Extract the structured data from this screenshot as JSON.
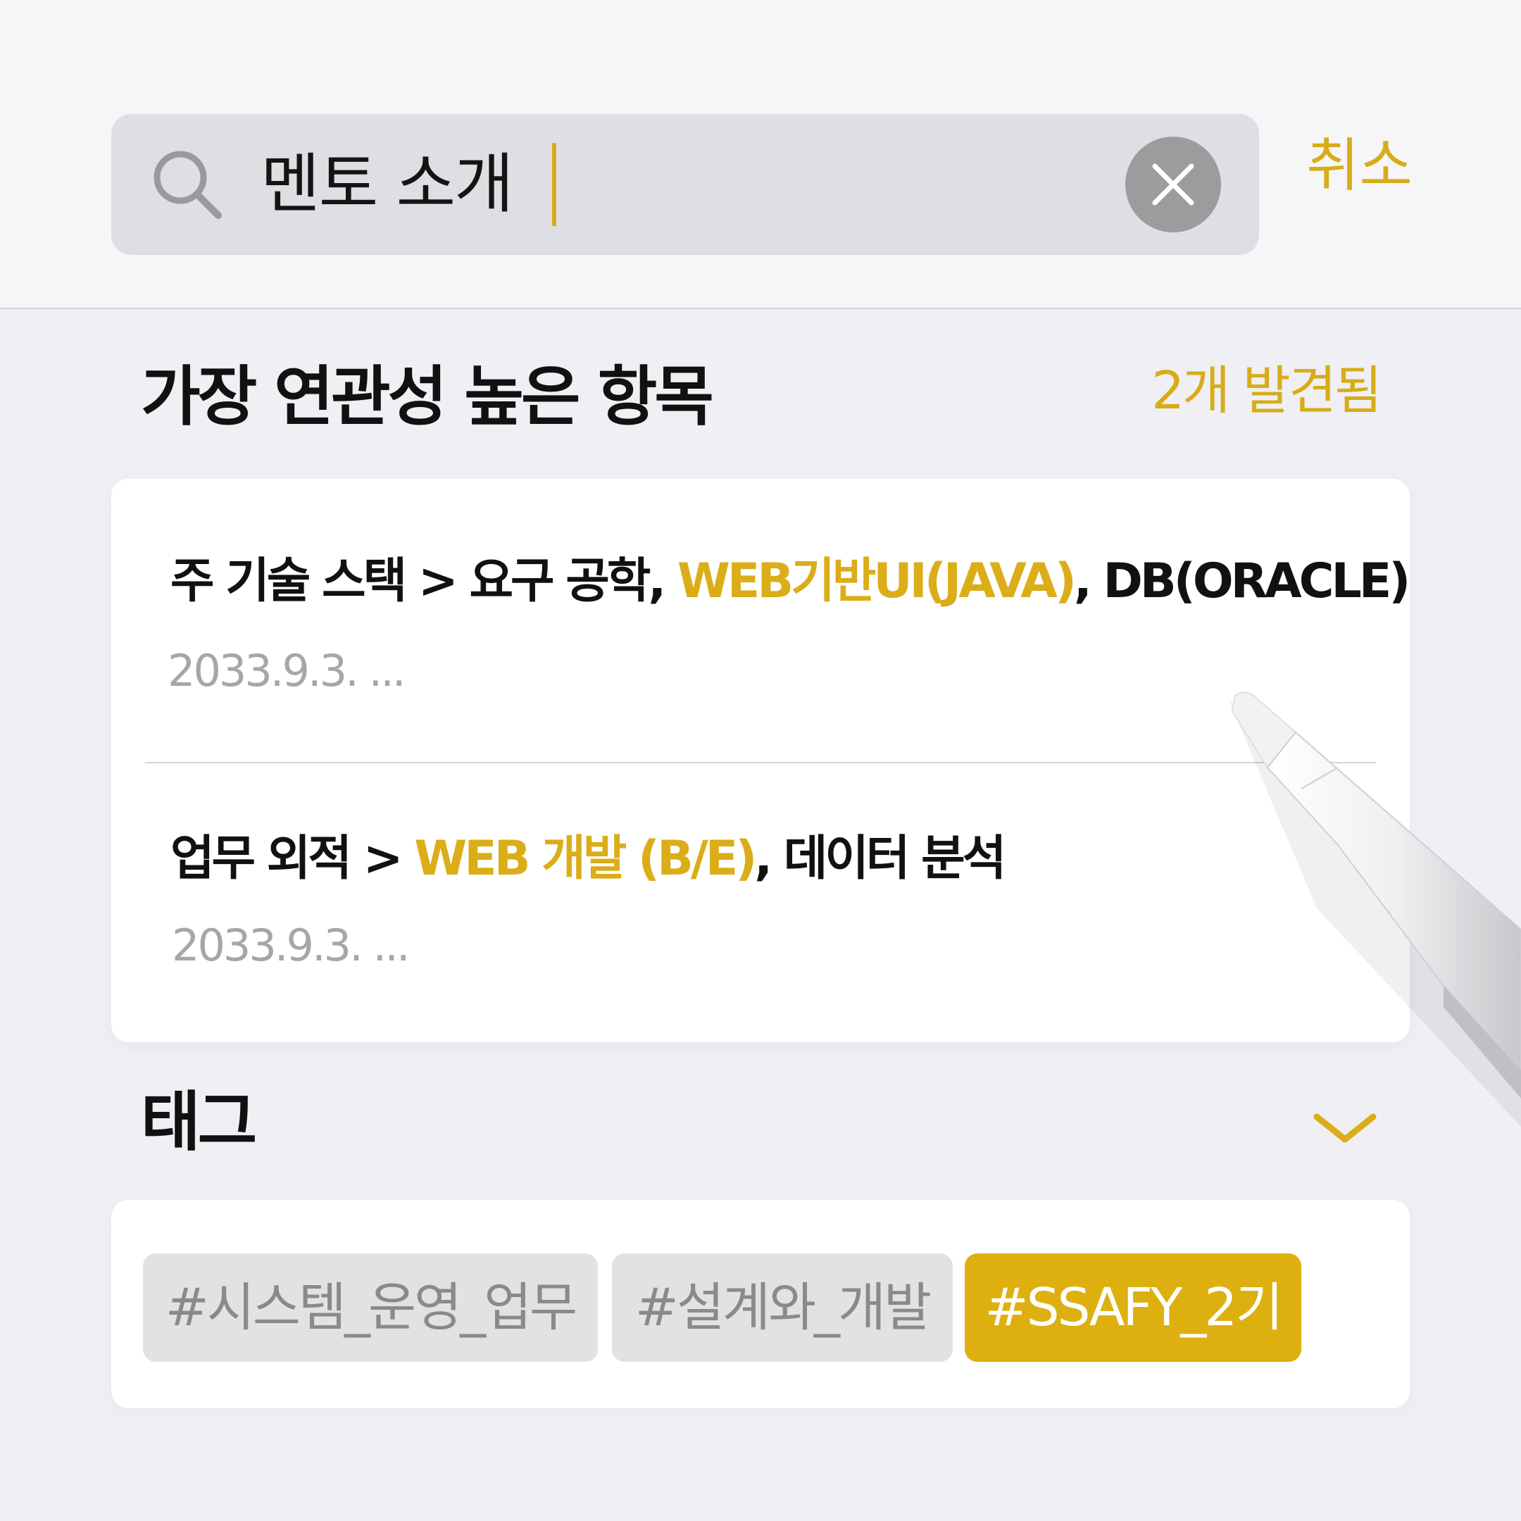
{
  "search": {
    "query": "멘토 소개",
    "cancel_label": "취소"
  },
  "results": {
    "title": "가장 연관성 높은 항목",
    "count_label": "2개 발견됨",
    "items": [
      {
        "title_prefix": "주 기술 스택 > 요구 공학, ",
        "title_highlight": "WEB기반UI(JAVA)",
        "title_suffix": ", DB(ORACLE)",
        "date": "2033.9.3.  ..."
      },
      {
        "title_prefix": "업무 외적 > ",
        "title_highlight": "WEB 개발 (B/E)",
        "title_suffix": ", 데이터 분석",
        "date": "2033.9.3.  ..."
      }
    ]
  },
  "tags": {
    "title": "태그",
    "items": [
      {
        "label": "#시스템_운영_업무",
        "selected": false
      },
      {
        "label": "#설계와_개발",
        "selected": false
      },
      {
        "label": "#SSAFY_2기",
        "selected": true
      }
    ]
  },
  "colors": {
    "accent": "#dbad18",
    "background": "#efeff4",
    "search_field": "#dfdfe3",
    "tag_gray": "#e2e2e4",
    "clear_button": "#9c9c9e"
  },
  "icons": [
    "search-icon",
    "clear-icon",
    "chevron-down-icon",
    "pencil-illustration"
  ]
}
